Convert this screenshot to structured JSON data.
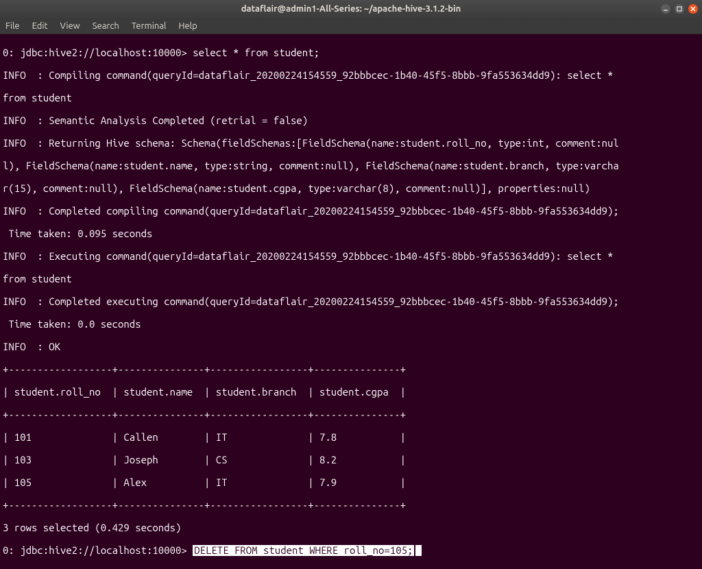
{
  "window": {
    "title": "dataflair@admin1-All-Series: ~/apache-hive-3.1.2-bin"
  },
  "menu": {
    "file": "File",
    "edit": "Edit",
    "view": "View",
    "search": "Search",
    "terminal": "Terminal",
    "help": "Help"
  },
  "terminal": {
    "line1": "0: jdbc:hive2://localhost:10000> select * from student;",
    "line2": "INFO  : Compiling command(queryId=dataflair_20200224154559_92bbbcec-1b40-45f5-8bbb-9fa553634dd9): select *",
    "line3": "from student",
    "line4": "INFO  : Semantic Analysis Completed (retrial = false)",
    "line5": "INFO  : Returning Hive schema: Schema(fieldSchemas:[FieldSchema(name:student.roll_no, type:int, comment:nul",
    "line6": "l), FieldSchema(name:student.name, type:string, comment:null), FieldSchema(name:student.branch, type:varcha",
    "line7": "r(15), comment:null), FieldSchema(name:student.cgpa, type:varchar(8), comment:null)], properties:null)",
    "line8": "INFO  : Completed compiling command(queryId=dataflair_20200224154559_92bbbcec-1b40-45f5-8bbb-9fa553634dd9);",
    "line9": " Time taken: 0.095 seconds",
    "line10": "INFO  : Executing command(queryId=dataflair_20200224154559_92bbbcec-1b40-45f5-8bbb-9fa553634dd9): select *",
    "line11": "from student",
    "line12": "INFO  : Completed executing command(queryId=dataflair_20200224154559_92bbbcec-1b40-45f5-8bbb-9fa553634dd9);",
    "line13": " Time taken: 0.0 seconds",
    "line14": "INFO  : OK",
    "sep1": "+------------------+---------------+-----------------+---------------+",
    "header": "| student.roll_no  | student.name  | student.branch  | student.cgpa  |",
    "sep2": "+------------------+---------------+-----------------+---------------+",
    "row1": "| 101              | Callen        | IT              | 7.8           |",
    "row2": "| 103              | Joseph        | CS              | 8.2           |",
    "row3": "| 105              | Alex          | IT              | 7.9           |",
    "sep3": "+------------------+---------------+-----------------+---------------+",
    "summary": "3 rows selected (0.429 seconds)",
    "prompt": "0: jdbc:hive2://localhost:10000> ",
    "input": "DELETE FROM student WHERE roll_no=105;"
  },
  "chart_data": {
    "type": "table",
    "title": "student",
    "columns": [
      "student.roll_no",
      "student.name",
      "student.branch",
      "student.cgpa"
    ],
    "rows": [
      [
        101,
        "Callen",
        "IT",
        7.8
      ],
      [
        103,
        "Joseph",
        "CS",
        8.2
      ],
      [
        105,
        "Alex",
        "IT",
        7.9
      ]
    ]
  }
}
